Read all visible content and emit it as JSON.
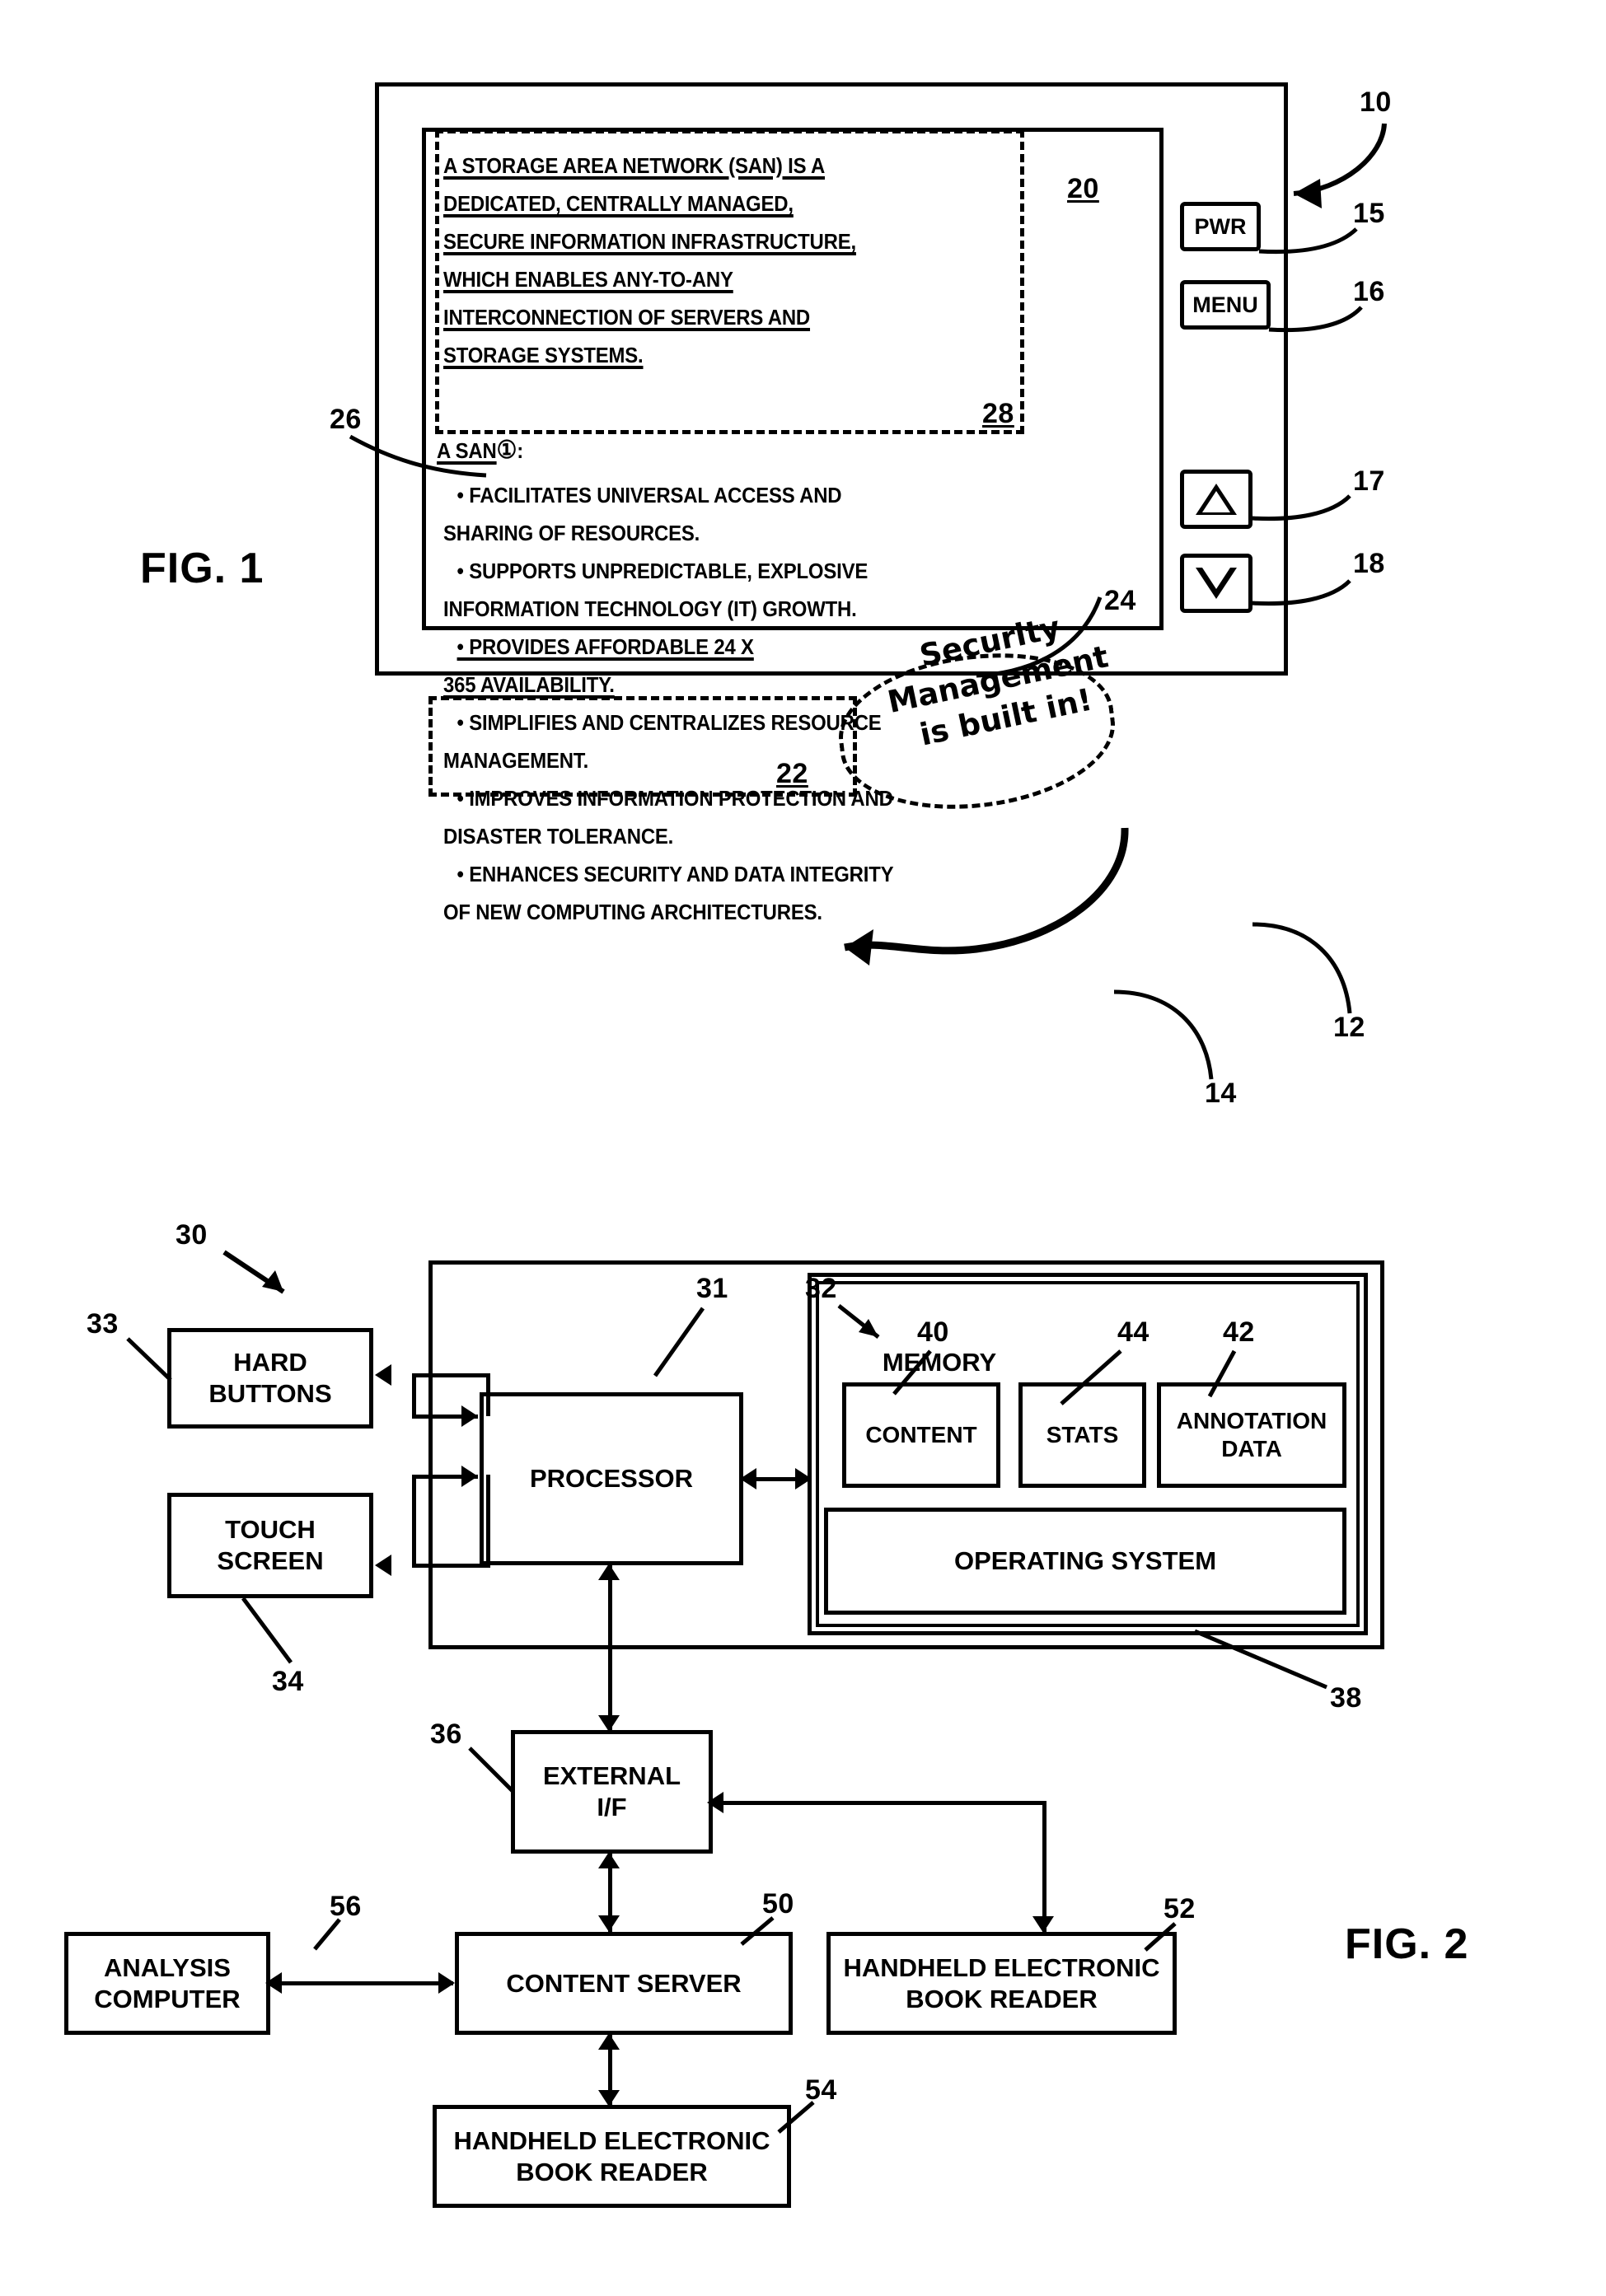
{
  "figures": [
    {
      "id": "fig1",
      "label": "FIG. 1"
    },
    {
      "id": "fig2",
      "label": "FIG. 2"
    }
  ],
  "fig1": {
    "label": "FIG. 1",
    "device_ref": "10",
    "housing_ref": "12",
    "screen_ref": "14",
    "page_ref": "20",
    "highlight_22_ref": "22",
    "note_24_ref": "24",
    "annot_marker_ref": "26",
    "highlight_28_ref": "28",
    "hard_buttons": [
      {
        "label": "PWR",
        "ref": "15"
      },
      {
        "label": "MENU",
        "ref": "16"
      },
      {
        "label": "up-arrow",
        "ref": "17"
      },
      {
        "label": "down-arrow",
        "ref": "18"
      }
    ],
    "ebook_text": {
      "paragraph_lines": [
        "A STORAGE AREA NETWORK (SAN) IS A",
        "DEDICATED, CENTRALLY MANAGED,",
        "SECURE INFORMATION INFRASTRUCTURE,",
        "WHICH ENABLES ANY-TO-ANY",
        "INTERCONNECTION OF SERVERS AND",
        "STORAGE SYSTEMS."
      ],
      "lead_in": "A SAN",
      "lead_in_marker": "①",
      "lead_in_colon": ":",
      "bullets": [
        {
          "lines": [
            "• FACILITATES UNIVERSAL ACCESS AND",
            "SHARING OF RESOURCES."
          ],
          "highlighted": false
        },
        {
          "lines": [
            "• SUPPORTS UNPREDICTABLE, EXPLOSIVE",
            "INFORMATION TECHNOLOGY (IT) GROWTH."
          ],
          "highlighted": false
        },
        {
          "lines": [
            "• PROVIDES AFFORDABLE 24 X",
            "365 AVAILABILITY."
          ],
          "highlighted": true
        },
        {
          "lines": [
            "• SIMPLIFIES AND CENTRALIZES RESOURCE",
            "MANAGEMENT."
          ],
          "highlighted": false
        },
        {
          "lines": [
            "• IMPROVES INFORMATION PROTECTION AND",
            "DISASTER TOLERANCE."
          ],
          "highlighted": false
        },
        {
          "lines": [
            "• ENHANCES SECURITY AND DATA INTEGRITY",
            "OF NEW COMPUTING ARCHITECTURES."
          ],
          "highlighted": false
        }
      ]
    },
    "handwritten_note": {
      "lines": [
        "Security",
        "Management",
        "is built in!"
      ],
      "ref": "24"
    }
  },
  "fig2": {
    "label": "FIG. 2",
    "system_ref": "30",
    "blocks": [
      {
        "name": "hard-buttons",
        "label": "HARD\nBUTTONS",
        "ref": "33"
      },
      {
        "name": "touch-screen",
        "label": "TOUCH\nSCREEN",
        "ref": "34"
      },
      {
        "name": "processor",
        "label": "PROCESSOR",
        "ref": "31"
      },
      {
        "name": "memory",
        "label": "MEMORY",
        "ref": "32"
      },
      {
        "name": "content",
        "label": "CONTENT",
        "ref": "40"
      },
      {
        "name": "stats",
        "label": "STATS",
        "ref": "44"
      },
      {
        "name": "annotation-data",
        "label": "ANNOTATION\nDATA",
        "ref": "42"
      },
      {
        "name": "operating-system",
        "label": "OPERATING SYSTEM",
        "ref": "38"
      },
      {
        "name": "external-if",
        "label": "EXTERNAL\nI/F",
        "ref": "36"
      },
      {
        "name": "content-server",
        "label": "CONTENT SERVER",
        "ref": "50"
      },
      {
        "name": "analysis-computer",
        "label": "ANALYSIS\nCOMPUTER",
        "ref": "56"
      },
      {
        "name": "handheld-reader-52",
        "label": "HANDHELD ELECTRONIC\nBOOK READER",
        "ref": "52"
      },
      {
        "name": "handheld-reader-54",
        "label": "HANDHELD ELECTRONIC\nBOOK READER",
        "ref": "54"
      }
    ],
    "labels": {
      "hard_buttons_l1": "HARD",
      "hard_buttons_l2": "BUTTONS",
      "touch_screen_l1": "TOUCH",
      "touch_screen_l2": "SCREEN",
      "processor": "PROCESSOR",
      "memory": "MEMORY",
      "content": "CONTENT",
      "stats": "STATS",
      "annotation_l1": "ANNOTATION",
      "annotation_l2": "DATA",
      "operating_system": "OPERATING SYSTEM",
      "external_l1": "EXTERNAL",
      "external_l2": "I/F",
      "content_server": "CONTENT SERVER",
      "analysis_l1": "ANALYSIS",
      "analysis_l2": "COMPUTER",
      "handheld_l1": "HANDHELD ELECTRONIC",
      "handheld_l2": "BOOK READER"
    },
    "refs": {
      "r30": "30",
      "r31": "31",
      "r32": "32",
      "r33": "33",
      "r34": "34",
      "r36": "36",
      "r38": "38",
      "r40": "40",
      "r42": "42",
      "r44": "44",
      "r50": "50",
      "r52": "52",
      "r54": "54",
      "r56": "56"
    }
  }
}
